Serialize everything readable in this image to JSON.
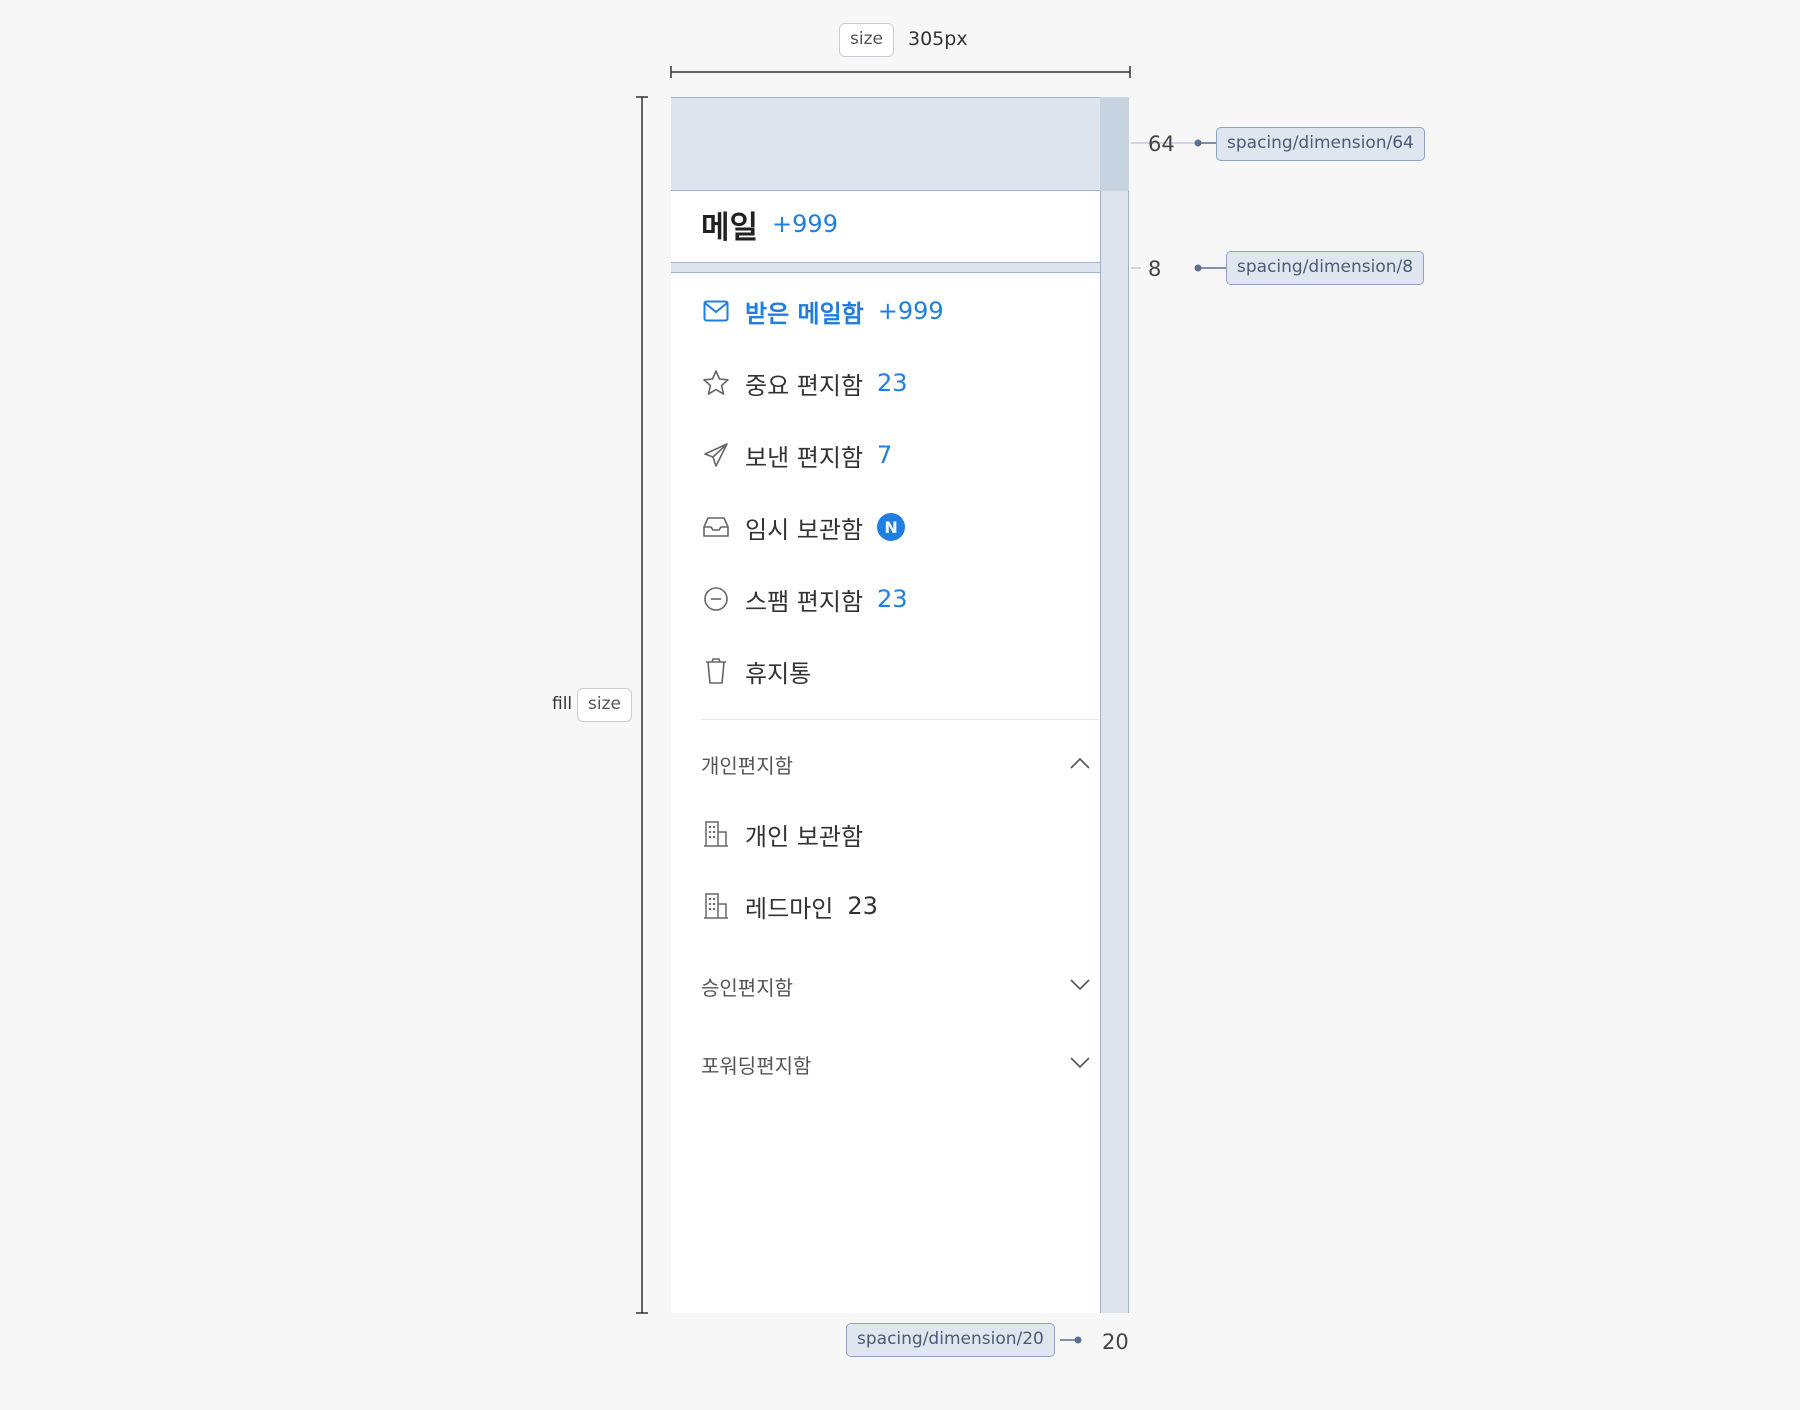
{
  "annotations": {
    "width_tag": "size",
    "width_value": "305px",
    "height_prefix": "fill",
    "height_tag": "size",
    "top_pad_value": "64",
    "top_pad_token": "spacing/dimension/64",
    "gap_value": "8",
    "gap_token": "spacing/dimension/8",
    "right_pad_value": "20",
    "right_pad_token": "spacing/dimension/20"
  },
  "panel": {
    "title": "메일",
    "title_count": "+999",
    "items": [
      {
        "label": "받은 메일함",
        "count": "+999",
        "icon": "mail-icon",
        "active": true
      },
      {
        "label": "중요 편지함",
        "count": "23",
        "icon": "star-icon"
      },
      {
        "label": "보낸 편지함",
        "count": "7",
        "icon": "send-icon"
      },
      {
        "label": "임시 보관함",
        "badge": "N",
        "icon": "inbox-tray-icon"
      },
      {
        "label": "스팸 편지함",
        "count": "23",
        "icon": "minus-circle-icon"
      },
      {
        "label": "휴지통",
        "icon": "trash-icon"
      }
    ],
    "sections": [
      {
        "label": "개인편지함",
        "expanded": true,
        "items": [
          {
            "label": "개인 보관함",
            "icon": "building-icon"
          },
          {
            "label": "레드마인",
            "count": "23",
            "icon": "building-icon"
          }
        ]
      },
      {
        "label": "승인편지함",
        "expanded": false
      },
      {
        "label": "포워딩편지함",
        "expanded": false
      }
    ]
  },
  "colors": {
    "accent": "#1f7ee0",
    "spacing_fill": "#dde4ed",
    "spacing_border": "#9fb3cf"
  }
}
